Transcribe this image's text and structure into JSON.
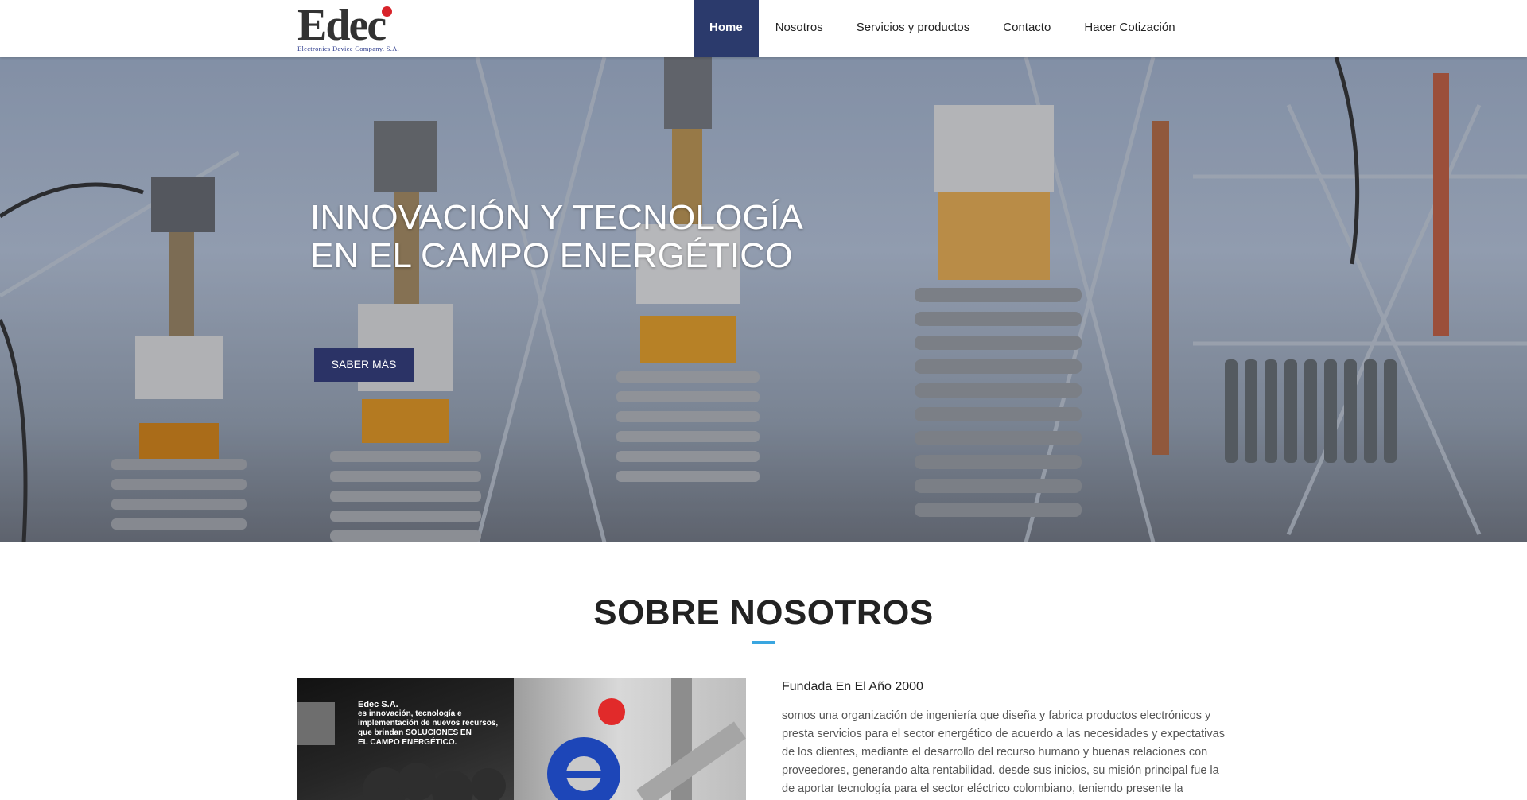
{
  "header": {
    "logo": {
      "wordmark": "Edec",
      "tagline": "Electronics Device Company. S.A."
    },
    "nav": [
      {
        "label": "Home",
        "active": true
      },
      {
        "label": "Nosotros",
        "active": false
      },
      {
        "label": "Servicios y productos",
        "active": false
      },
      {
        "label": "Contacto",
        "active": false
      },
      {
        "label": "Hacer Cotización",
        "active": false
      }
    ]
  },
  "hero": {
    "title_line1": "INNOVACIÓN Y TECNOLOGÍA",
    "title_line2": "EN EL CAMPO ENERGÉTICO",
    "button_label": "SABER MÁS"
  },
  "about": {
    "title": "SOBRE NOSOTROS",
    "image_caption": {
      "line1": "Edec S.A.",
      "line2": "es innovación, tecnología e",
      "line3": "implementación de nuevos recursos,",
      "line4": "que brindan SOLUCIONES EN",
      "line5": "EL CAMPO ENERGÉTICO."
    },
    "subtitle": "Fundada En El Año 2000",
    "text": "somos una organización de ingeniería que diseña y fabrica productos electrónicos y presta servicios para el sector energético de acuerdo a las necesidades y expectativas de los clientes, mediante el desarrollo del recurso humano y buenas relaciones con proveedores, generando alta rentabilidad. desde sus inicios, su misión principal fue la de aportar tecnología para el sector eléctrico colombiano, teniendo presente la"
  },
  "colors": {
    "nav_active": "#2b3a6c",
    "button": "#2b3366",
    "accent": "#3aa6e0",
    "logo_blue": "#2b3a8c",
    "logo_red": "#d8232a"
  }
}
